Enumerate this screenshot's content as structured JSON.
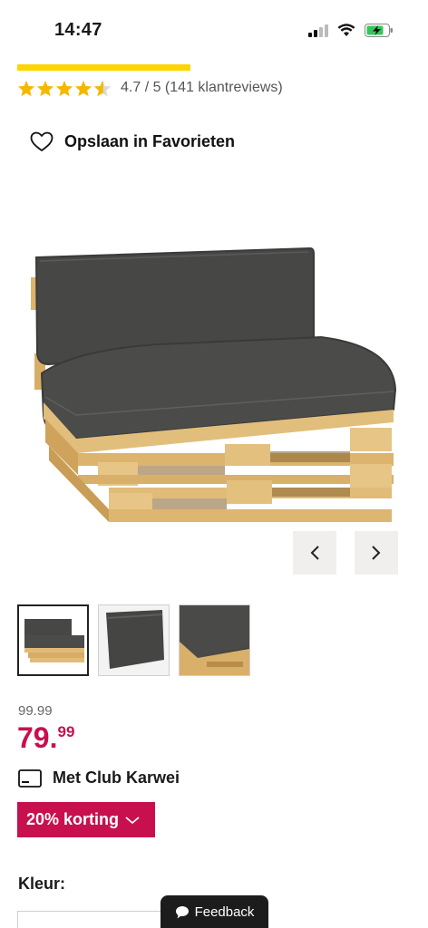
{
  "status_bar": {
    "time": "14:47"
  },
  "rating": {
    "text": "4.7 / 5 (141 klantreviews)",
    "star_color": "#f5b800",
    "value": 4.7
  },
  "favorite": {
    "label": "Opslaan in Favorieten"
  },
  "gallery": {
    "prev_icon": "chevron-left-icon",
    "next_icon": "chevron-right-icon"
  },
  "price": {
    "old": "99.99",
    "main": "79.",
    "cents": "99",
    "color": "#c8104e"
  },
  "club": {
    "label": "Met Club Karwei"
  },
  "discount": {
    "label": "20% korting"
  },
  "color_section": {
    "label": "Kleur:"
  },
  "feedback": {
    "label": "Feedback"
  }
}
